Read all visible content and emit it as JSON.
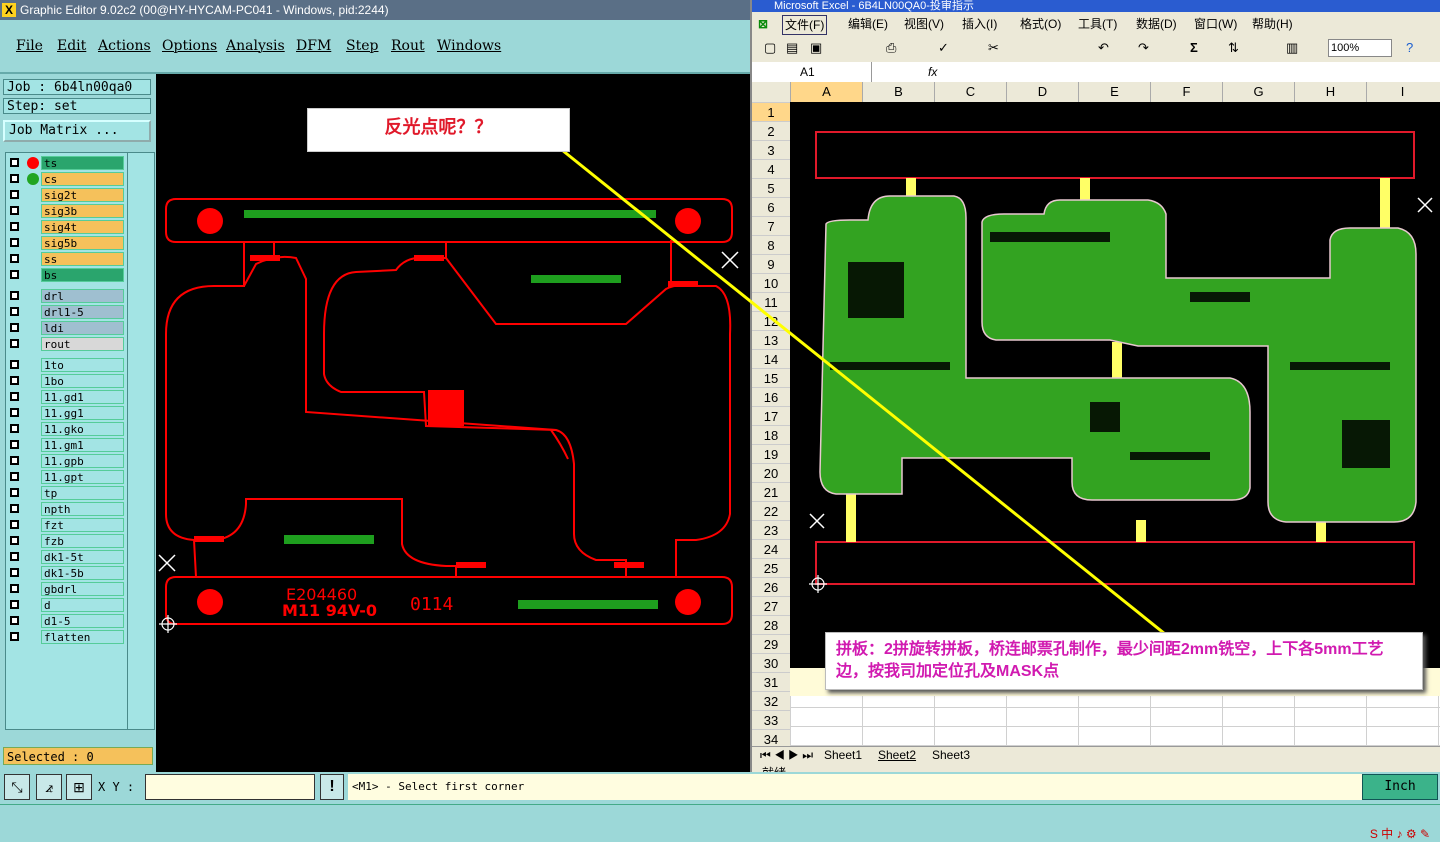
{
  "editor": {
    "title": "Graphic Editor 9.02c2 (00@HY-HYCAM-PC041 - Windows, pid:2244)",
    "menu": [
      "File",
      "Edit",
      "Actions",
      "Options",
      "Analysis",
      "DFM",
      "Step",
      "Rout",
      "Windows"
    ],
    "job": "Job : 6b4ln00qa0",
    "step": "Step: set",
    "job_matrix": "Job Matrix ...",
    "layers_board": [
      {
        "name": "ts",
        "color": "#2aa56d",
        "dot": "#ff0000"
      },
      {
        "name": "cs",
        "color": "#f5c15b",
        "dot": "#21a521"
      },
      {
        "name": "sig2t",
        "color": "#f5c15b"
      },
      {
        "name": "sig3b",
        "color": "#f5c15b"
      },
      {
        "name": "sig4t",
        "color": "#f5c15b"
      },
      {
        "name": "sig5b",
        "color": "#f5c15b"
      },
      {
        "name": "ss",
        "color": "#f5c15b"
      },
      {
        "name": "bs",
        "color": "#2aa56d"
      }
    ],
    "layers_drill": [
      {
        "name": "drl",
        "color": "#9fbfd0"
      },
      {
        "name": "drl1-5",
        "color": "#9fbfd0"
      },
      {
        "name": "ldi",
        "color": "#9fbfd0"
      },
      {
        "name": "rout",
        "color": "#d8d8d8"
      }
    ],
    "layers_misc": [
      "1to",
      "1bo",
      "11.gd1",
      "11.gg1",
      "11.gko",
      "11.gm1",
      "11.gpb",
      "11.gpt",
      "tp",
      "npth",
      "fzt",
      "fzb",
      "dk1-5t",
      "dk1-5b",
      "gbdrl",
      "d",
      "d1-5",
      "flatten"
    ],
    "selected": "Selected : 0",
    "xy_label": "X Y :",
    "prompt": "<M1> - Select first corner",
    "units": "Inch",
    "board_marking_1": "E204460",
    "board_marking_2": "M11 94V-0",
    "board_marking_3": "0114",
    "colors": {
      "outline": "#ff0000",
      "pads": "#1e9e1e"
    }
  },
  "excel": {
    "title": "Microsoft Excel - 6B4LN00QA0-投审指示",
    "menu": [
      "文件(F)",
      "编辑(E)",
      "视图(V)",
      "插入(I)",
      "格式(O)",
      "工具(T)",
      "数据(D)",
      "窗口(W)",
      "帮助(H)"
    ],
    "zoom": "100%",
    "name_box": "A1",
    "fx": "fx",
    "columns": [
      "A",
      "B",
      "C",
      "D",
      "E",
      "F",
      "G",
      "H",
      "I"
    ],
    "rows": [
      "1",
      "2",
      "3",
      "4",
      "5",
      "6",
      "7",
      "8",
      "9",
      "10",
      "11",
      "12",
      "13",
      "14",
      "15",
      "16",
      "17",
      "18",
      "19",
      "20",
      "21",
      "22",
      "23",
      "24",
      "25",
      "26",
      "27",
      "28",
      "29",
      "30",
      "31",
      "32",
      "33",
      "34"
    ],
    "sheets": [
      "Sheet1",
      "Sheet2",
      "Sheet3"
    ],
    "status": "就绪",
    "colors": {
      "pcb": "#33a321",
      "rail": "#e0192a",
      "tab": "#ffff66"
    }
  },
  "annotations": {
    "note1": "反光点呢？？",
    "note2": "拼板：2拼旋转拼板，桥连邮票孔制作，最少间距2mm铣空，上下各5mm工艺边，按我司加定位孔及MASK点"
  }
}
